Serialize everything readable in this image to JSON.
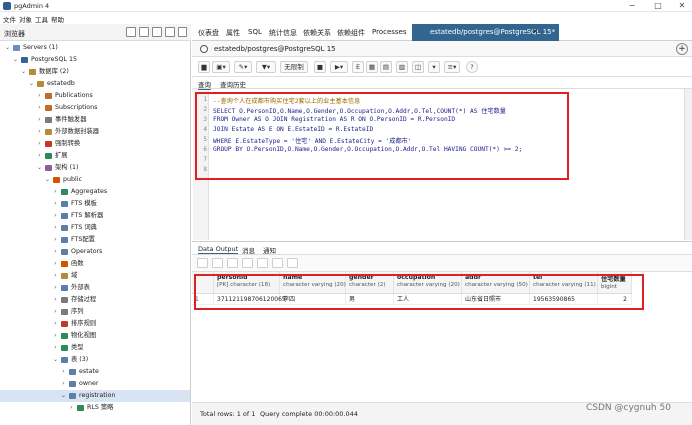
{
  "window": {
    "title": "pgAdmin 4"
  },
  "menu": [
    "文件",
    "对象",
    "工具",
    "帮助"
  ],
  "browser": {
    "label": "浏览器",
    "tree": [
      {
        "label": "Servers (1)",
        "indent": 0,
        "caret": "down",
        "color": "#6b8fb8"
      },
      {
        "label": "PostgreSQL 15",
        "indent": 1,
        "caret": "down",
        "color": "#336791"
      },
      {
        "label": "数据库 (2)",
        "indent": 2,
        "caret": "down",
        "color": "#b58a3a"
      },
      {
        "label": "estatedb",
        "indent": 3,
        "caret": "down",
        "color": "#b58a3a"
      },
      {
        "label": "Publications",
        "indent": 4,
        "caret": "right",
        "color": "#c06a30"
      },
      {
        "label": "Subscriptions",
        "indent": 4,
        "caret": "right",
        "color": "#c06a30"
      },
      {
        "label": "事件触发器",
        "indent": 4,
        "caret": "right",
        "color": "#7a7a7a"
      },
      {
        "label": "外部数据封装器",
        "indent": 4,
        "caret": "right",
        "color": "#b58a3a"
      },
      {
        "label": "强制转换",
        "indent": 4,
        "caret": "right",
        "color": "#c0392b"
      },
      {
        "label": "扩展",
        "indent": 4,
        "caret": "right",
        "color": "#2e8b57"
      },
      {
        "label": "架构 (1)",
        "indent": 4,
        "caret": "down",
        "color": "#8e5ea2"
      },
      {
        "label": "public",
        "indent": 5,
        "caret": "down",
        "color": "#d35400"
      },
      {
        "label": "Aggregates",
        "indent": 6,
        "caret": "right",
        "color": "#2e8b57"
      },
      {
        "label": "FTS 模板",
        "indent": 6,
        "caret": "right",
        "color": "#5a7fa8"
      },
      {
        "label": "FTS 解析器",
        "indent": 6,
        "caret": "right",
        "color": "#5a7fa8"
      },
      {
        "label": "FTS 词典",
        "indent": 6,
        "caret": "right",
        "color": "#5a7fa8"
      },
      {
        "label": "FTS配置",
        "indent": 6,
        "caret": "right",
        "color": "#5a7fa8"
      },
      {
        "label": "Operators",
        "indent": 6,
        "caret": "right",
        "color": "#5a7fa8"
      },
      {
        "label": "函数",
        "indent": 6,
        "caret": "right",
        "color": "#d35400"
      },
      {
        "label": "域",
        "indent": 6,
        "caret": "right",
        "color": "#b58a3a"
      },
      {
        "label": "外部表",
        "indent": 6,
        "caret": "right",
        "color": "#5a7fa8"
      },
      {
        "label": "存储过程",
        "indent": 6,
        "caret": "right",
        "color": "#7a7a7a"
      },
      {
        "label": "序列",
        "indent": 6,
        "caret": "right",
        "color": "#7a7a7a"
      },
      {
        "label": "排序规则",
        "indent": 6,
        "caret": "right",
        "color": "#c0392b"
      },
      {
        "label": "物化视图",
        "indent": 6,
        "caret": "right",
        "color": "#2e8b57"
      },
      {
        "label": "类型",
        "indent": 6,
        "caret": "right",
        "color": "#2e8b57"
      },
      {
        "label": "表 (3)",
        "indent": 6,
        "caret": "down",
        "color": "#5a7fa8"
      },
      {
        "label": "estate",
        "indent": 7,
        "caret": "right",
        "color": "#5a7fa8"
      },
      {
        "label": "owner",
        "indent": 7,
        "caret": "right",
        "color": "#5a7fa8"
      },
      {
        "label": "registration",
        "indent": 7,
        "caret": "down",
        "color": "#5a7fa8",
        "selected": true
      },
      {
        "label": "RLS 策略",
        "indent": 8,
        "caret": "right",
        "color": "#2e8b57"
      }
    ]
  },
  "tabs": [
    "仪表盘",
    "属性",
    "SQL",
    "统计信息",
    "依赖关系",
    "依赖组件",
    "Processes"
  ],
  "active_tab": "estatedb/postgres@PostgreSQL 15*",
  "connection": "estatedb/postgres@PostgreSQL 15",
  "toolbar": {
    "limit": "无限制"
  },
  "subtabs": [
    "查询",
    "查询历史"
  ],
  "editor": {
    "line_numbers": [
      "1",
      "2",
      "3",
      "4",
      "5",
      "6",
      "7",
      "8"
    ],
    "lines": [
      "--查询个人在成都市购买住宅2套以上的业主基本信息",
      "SELECT O.PersonID,O.Name,O.Gender,O.Occupation,O.Addr,O.Tel,COUNT(*) AS 住宅数量",
      "FROM Owner AS O JOIN Registration AS R ON O.PersonID = R.PersonID",
      "JOIN Estate AS E ON E.EstateID = R.EstateID",
      "WHERE E.EstateType = '住宅' AND E.EstateCity = '成都市'",
      "GROUP BY O.PersonID,O.Name,O.Gender,O.Occupation,O.Addr,O.Tel HAVING COUNT(*) >= 2;",
      "",
      ""
    ]
  },
  "output_tabs": [
    "Data Output",
    "消息",
    "通知"
  ],
  "results": {
    "columns": [
      {
        "name": "personid",
        "type": "[PK] character (18)"
      },
      {
        "name": "name",
        "type": "character varying (20)"
      },
      {
        "name": "gender",
        "type": "character (2)"
      },
      {
        "name": "occupation",
        "type": "character varying (20)"
      },
      {
        "name": "addr",
        "type": "character varying (50)"
      },
      {
        "name": "tel",
        "type": "character varying (11)"
      },
      {
        "name": "住宅数量",
        "type": "bigint"
      }
    ],
    "rows": [
      {
        "num": "1",
        "cells": [
          "371121198706120065",
          "李四",
          "男",
          "工人",
          "山东省日照市",
          "19563590865",
          "2"
        ]
      }
    ]
  },
  "status": {
    "rows": "Total rows: 1 of 1",
    "query": "Query complete 00:00:00.044"
  },
  "watermark": "CSDN @cygnuh 50"
}
